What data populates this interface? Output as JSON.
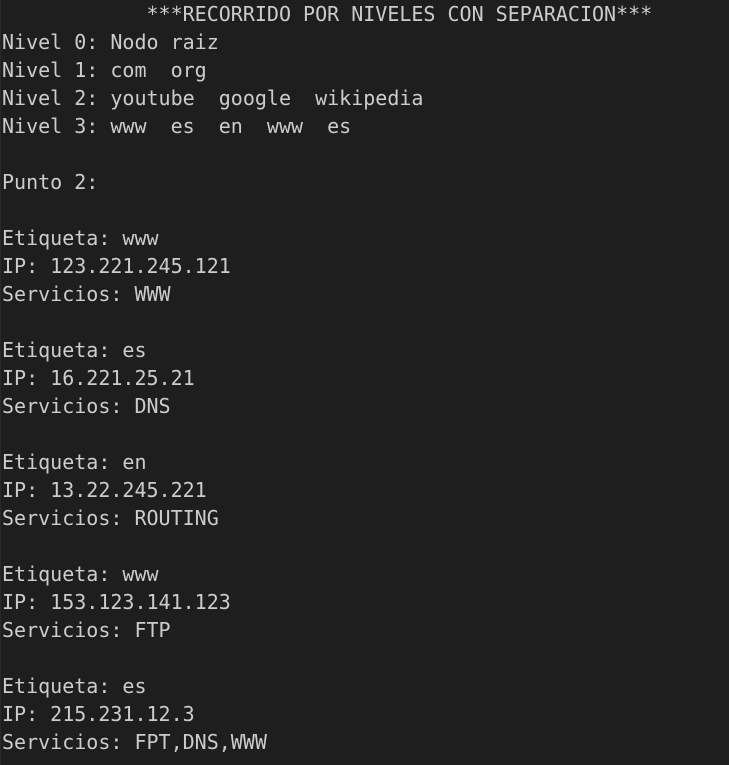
{
  "console": {
    "header": "            ***RECORRIDO POR NIVELES CON SEPARACION***",
    "levels": [
      "Nivel 0: Nodo raiz",
      "Nivel 1: com  org",
      "Nivel 2: youtube  google  wikipedia",
      "Nivel 3: www  es  en  www  es"
    ],
    "section_title": "Punto 2:",
    "entries": [
      {
        "label": "Etiqueta: www",
        "ip": "IP: 123.221.245.121",
        "services": "Servicios: WWW"
      },
      {
        "label": "Etiqueta: es",
        "ip": "IP: 16.221.25.21",
        "services": "Servicios: DNS"
      },
      {
        "label": "Etiqueta: en",
        "ip": "IP: 13.22.245.221",
        "services": "Servicios: ROUTING"
      },
      {
        "label": "Etiqueta: www",
        "ip": "IP: 153.123.141.123",
        "services": "Servicios: FTP"
      },
      {
        "label": "Etiqueta: es",
        "ip": "IP: 215.231.12.3",
        "services": "Servicios: FPT,DNS,WWW"
      }
    ]
  }
}
